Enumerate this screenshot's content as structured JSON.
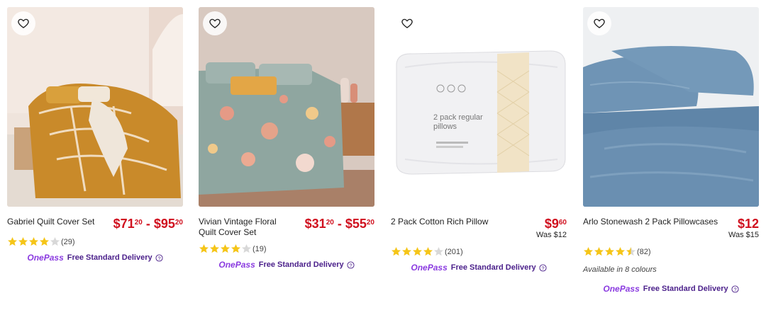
{
  "products": [
    {
      "name": "Gabriel Quilt Cover Set",
      "price_main_1": "$71",
      "price_cents_1": "20",
      "price_sep": " - ",
      "price_main_2": "$95",
      "price_cents_2": "20",
      "was": "",
      "rating": 4,
      "review_count": "(29)",
      "colours": "",
      "delivery_brand": "OnePass",
      "delivery_text": "Free Standard Delivery"
    },
    {
      "name": "Vivian Vintage Floral Quilt Cover Set",
      "price_main_1": "$31",
      "price_cents_1": "20",
      "price_sep": " - ",
      "price_main_2": "$55",
      "price_cents_2": "20",
      "was": "",
      "rating": 4,
      "review_count": "(19)",
      "colours": "",
      "delivery_brand": "OnePass",
      "delivery_text": "Free Standard Delivery"
    },
    {
      "name": "2 Pack Cotton Rich Pillow",
      "price_main_1": "$9",
      "price_cents_1": "60",
      "was": "Was $12",
      "rating": 4,
      "review_count": "(201)",
      "colours": "",
      "delivery_brand": "OnePass",
      "delivery_text": "Free Standard Delivery",
      "pillow_label": "2 pack regular pillows"
    },
    {
      "name": "Arlo Stonewash 2 Pack Pillowcases",
      "price_main_1": "$12",
      "price_cents_1": "",
      "was": "Was $15",
      "rating": 4.5,
      "review_count": "(82)",
      "colours": "Available in 8 colours",
      "delivery_brand": "OnePass",
      "delivery_text": "Free Standard Delivery"
    }
  ],
  "colors": {
    "price": "#d0101e",
    "star": "#f5c518",
    "onepass": "#8a3ae0"
  },
  "icons": {
    "wishlist": "heart-outline-icon",
    "star": "star-icon",
    "help": "question-circle-icon"
  }
}
